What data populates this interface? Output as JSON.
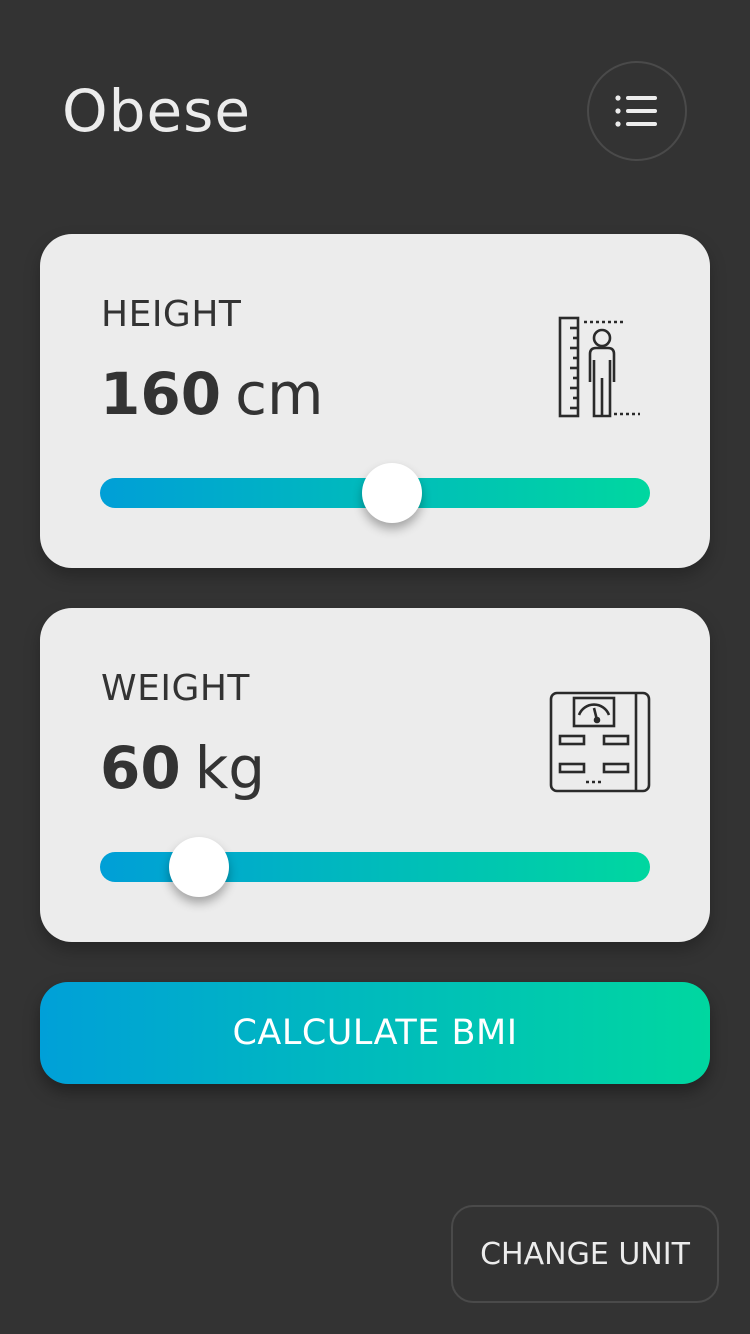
{
  "header": {
    "title": "Obese",
    "menu_icon": "list-menu-icon"
  },
  "height_card": {
    "label": "HEIGHT",
    "value": "160",
    "unit": "cm",
    "icon": "height-measure-icon",
    "slider_position": 0.53
  },
  "weight_card": {
    "label": "WEIGHT",
    "value": "60",
    "unit": "kg",
    "icon": "weighing-scale-icon",
    "slider_position": 0.18
  },
  "actions": {
    "calculate_label": "CALCULATE BMI",
    "change_unit_label": "CHANGE UNIT"
  },
  "colors": {
    "background": "#333333",
    "card": "#ececec",
    "gradient_start": "#009fd7",
    "gradient_end": "#00d7a0"
  }
}
